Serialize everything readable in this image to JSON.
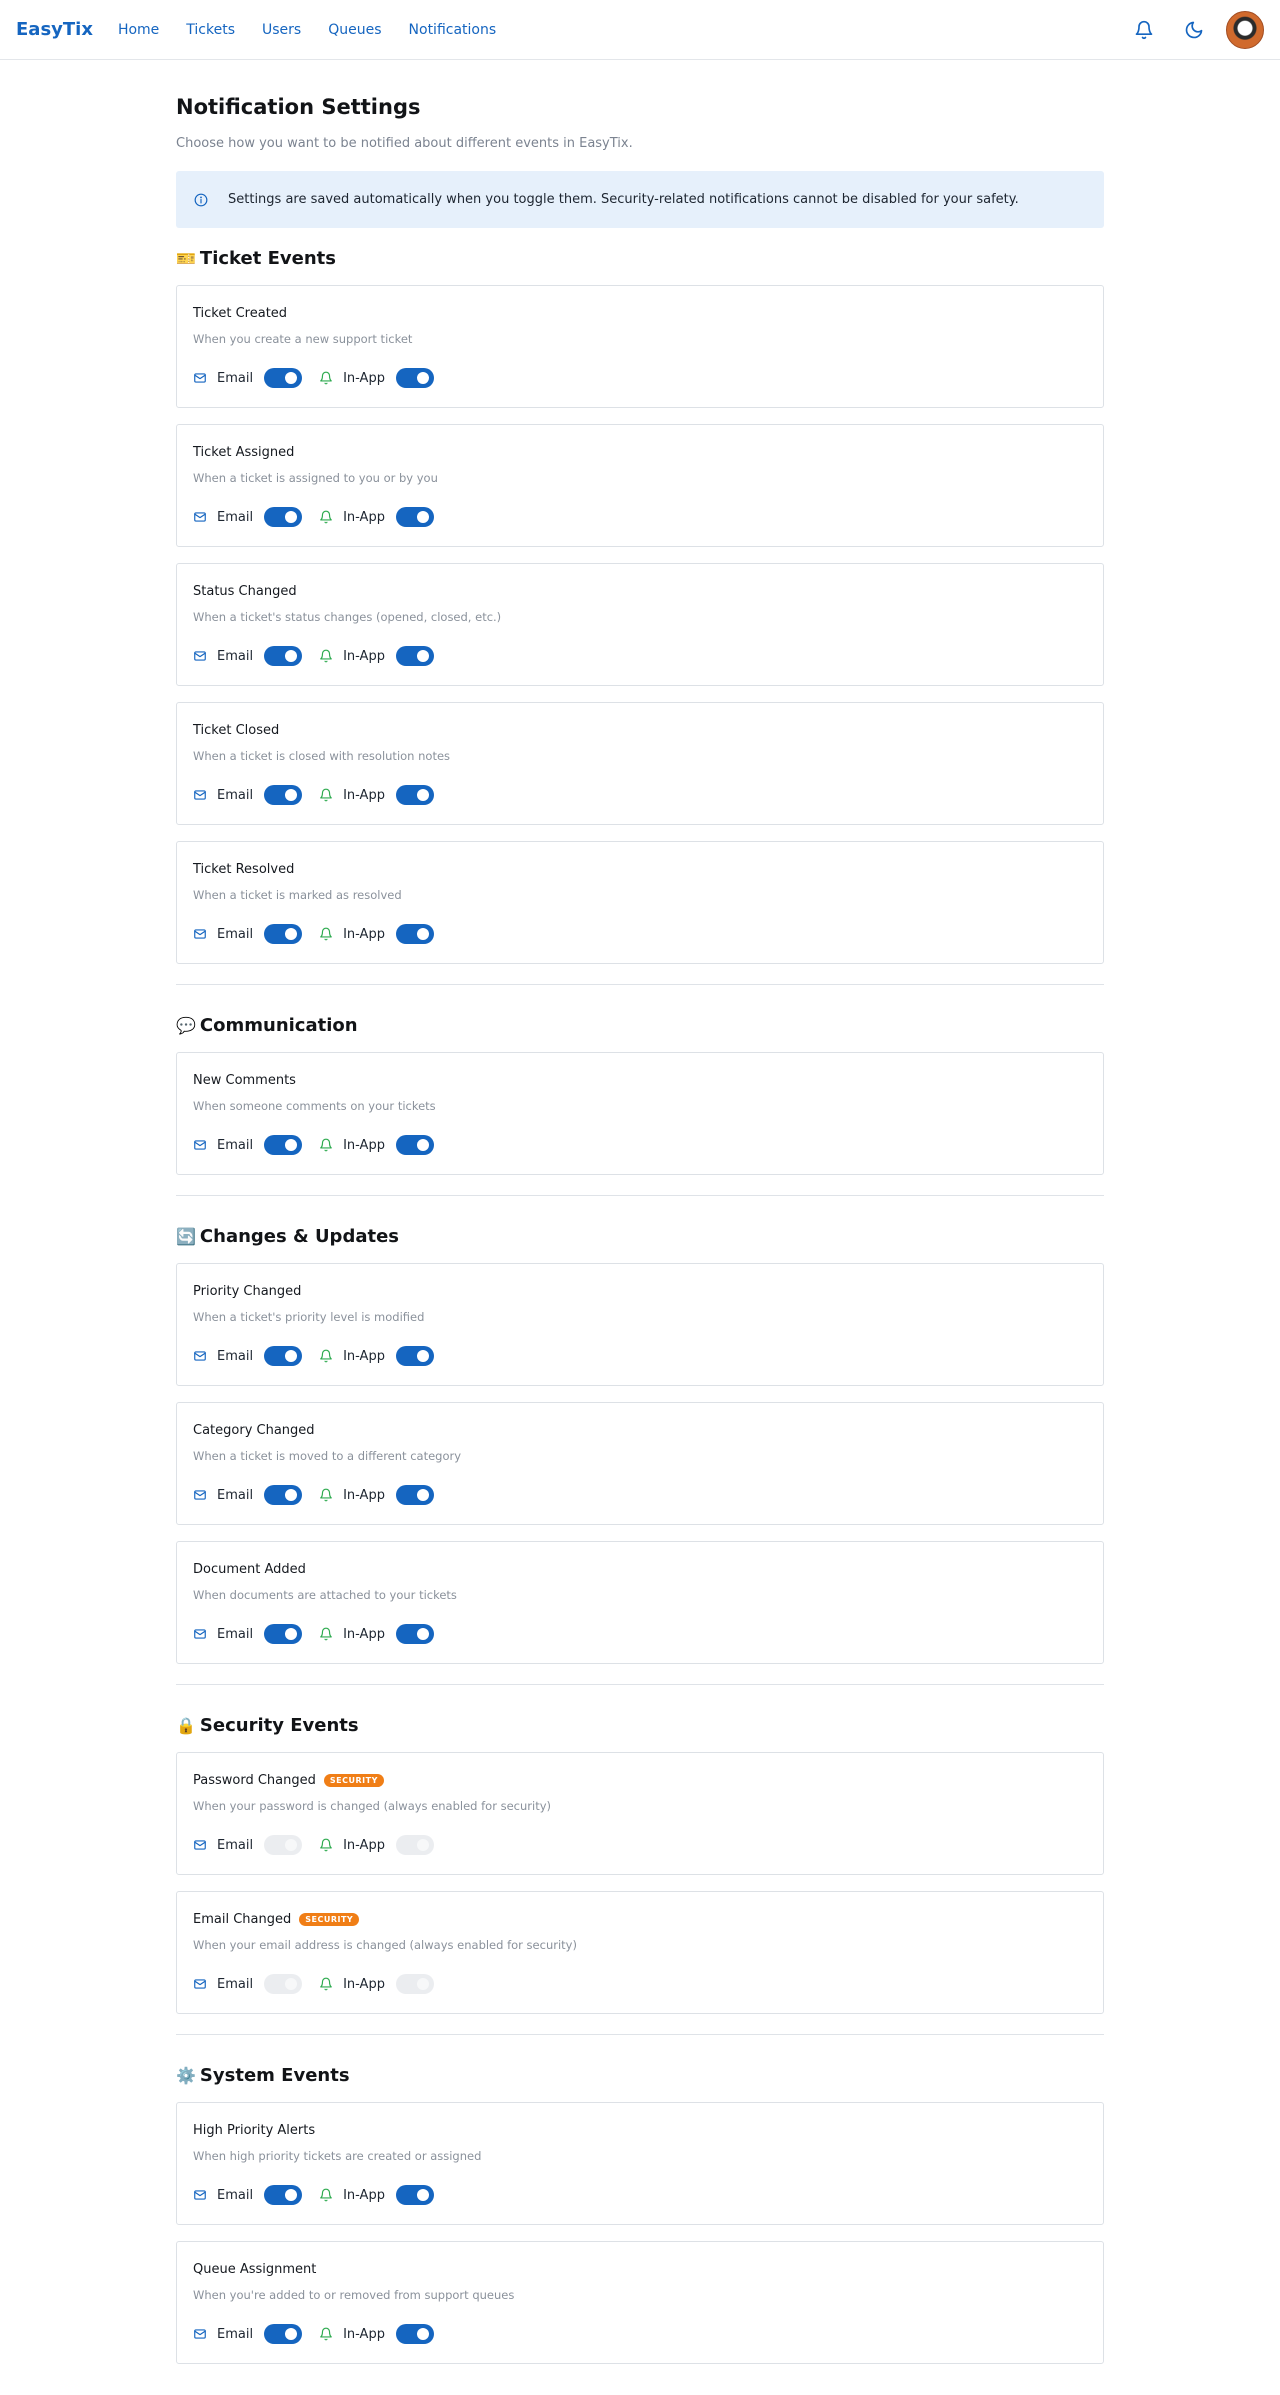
{
  "nav": {
    "brand": "EasyTix",
    "links": [
      "Home",
      "Tickets",
      "Users",
      "Queues",
      "Notifications"
    ]
  },
  "page": {
    "title": "Notification Settings",
    "subtitle": "Choose how you want to be notified about different events in EasyTix.",
    "info": "Settings are saved automatically when you toggle them. Security-related notifications cannot be disabled for your safety."
  },
  "labels": {
    "email": "Email",
    "inapp": "In-App"
  },
  "colors": {
    "accent": "#1565c0",
    "badge": "#f07e16",
    "info_bg": "#e6f0fb"
  },
  "sections": [
    {
      "emoji": "🎫",
      "title": "Ticket Events",
      "items": [
        {
          "title": "Ticket Created",
          "desc": "When you create a new support ticket",
          "email": true,
          "inapp": true
        },
        {
          "title": "Ticket Assigned",
          "desc": "When a ticket is assigned to you or by you",
          "email": true,
          "inapp": true
        },
        {
          "title": "Status Changed",
          "desc": "When a ticket's status changes (opened, closed, etc.)",
          "email": true,
          "inapp": true
        },
        {
          "title": "Ticket Closed",
          "desc": "When a ticket is closed with resolution notes",
          "email": true,
          "inapp": true
        },
        {
          "title": "Ticket Resolved",
          "desc": "When a ticket is marked as resolved",
          "email": true,
          "inapp": true
        }
      ]
    },
    {
      "emoji": "💬",
      "title": "Communication",
      "items": [
        {
          "title": "New Comments",
          "desc": "When someone comments on your tickets",
          "email": true,
          "inapp": true
        }
      ]
    },
    {
      "emoji": "🔄",
      "title": "Changes & Updates",
      "items": [
        {
          "title": "Priority Changed",
          "desc": "When a ticket's priority level is modified",
          "email": true,
          "inapp": true
        },
        {
          "title": "Category Changed",
          "desc": "When a ticket is moved to a different category",
          "email": true,
          "inapp": true
        },
        {
          "title": "Document Added",
          "desc": "When documents are attached to your tickets",
          "email": true,
          "inapp": true
        }
      ]
    },
    {
      "emoji": "🔒",
      "title": "Security Events",
      "items": [
        {
          "title": "Password Changed",
          "badge": "SECURITY",
          "desc": "When your password is changed (always enabled for security)",
          "email": false,
          "inapp": false,
          "disabled": true
        },
        {
          "title": "Email Changed",
          "badge": "SECURITY",
          "desc": "When your email address is changed (always enabled for security)",
          "email": false,
          "inapp": false,
          "disabled": true
        }
      ]
    },
    {
      "emoji": "⚙️",
      "title": "System Events",
      "items": [
        {
          "title": "High Priority Alerts",
          "desc": "When high priority tickets are created or assigned",
          "email": true,
          "inapp": true
        },
        {
          "title": "Queue Assignment",
          "desc": "When you're added to or removed from support queues",
          "email": true,
          "inapp": true
        }
      ]
    }
  ]
}
